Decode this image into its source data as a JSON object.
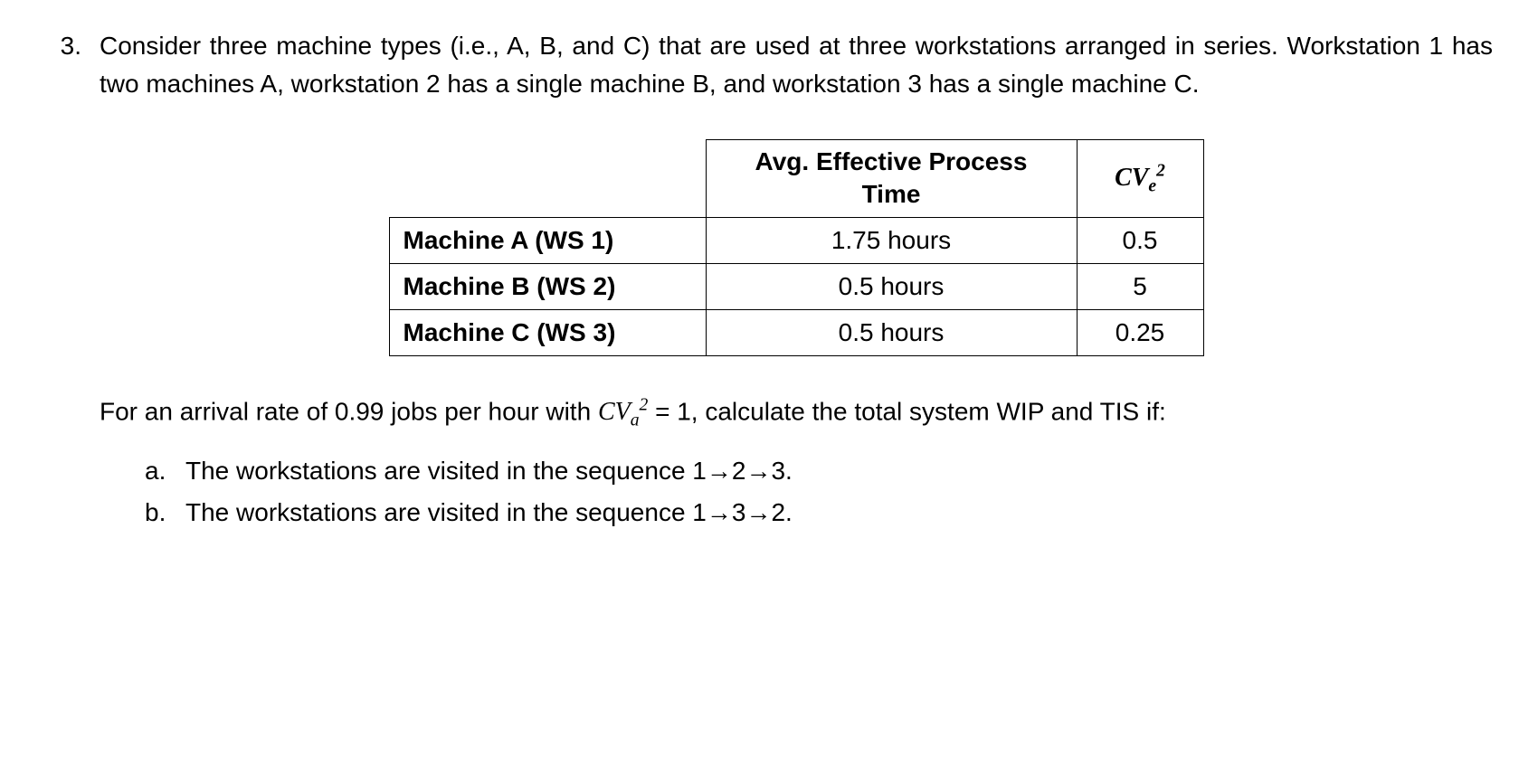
{
  "problem": {
    "number": "3.",
    "intro": "Consider three machine types (i.e., A, B, and C) that are used at three workstations arranged in series. Workstation 1 has two machines A, workstation 2 has a single machine B, and workstation 3 has a single machine C."
  },
  "chart_data": {
    "type": "table",
    "headers": {
      "process_time": "Avg. Effective Process Time",
      "cv": "CV",
      "cv_sub": "e",
      "cv_sup": "2"
    },
    "rows": [
      {
        "label": "Machine A (WS 1)",
        "time": "1.75 hours",
        "cv": "0.5"
      },
      {
        "label": "Machine B (WS 2)",
        "time": "0.5 hours",
        "cv": "5"
      },
      {
        "label": "Machine C (WS 3)",
        "time": "0.5 hours",
        "cv": "0.25"
      }
    ]
  },
  "after_table": {
    "text_part1": "For an arrival rate of 0.99 jobs per hour with ",
    "cv_a": "CV",
    "cv_a_sub": "a",
    "cv_a_sup": "2",
    "eq_val": " = 1",
    "text_part2": ", calculate the total system WIP and TIS if:"
  },
  "subparts": {
    "a": {
      "letter": "a.",
      "text_before": "The workstations are visited in the sequence 1",
      "arrow1": "→",
      "mid1": "2",
      "arrow2": "→",
      "end": "3."
    },
    "b": {
      "letter": "b.",
      "text_before": "The workstations are visited in the sequence 1",
      "arrow1": "→",
      "mid1": "3",
      "arrow2": "→",
      "end": "2."
    }
  }
}
